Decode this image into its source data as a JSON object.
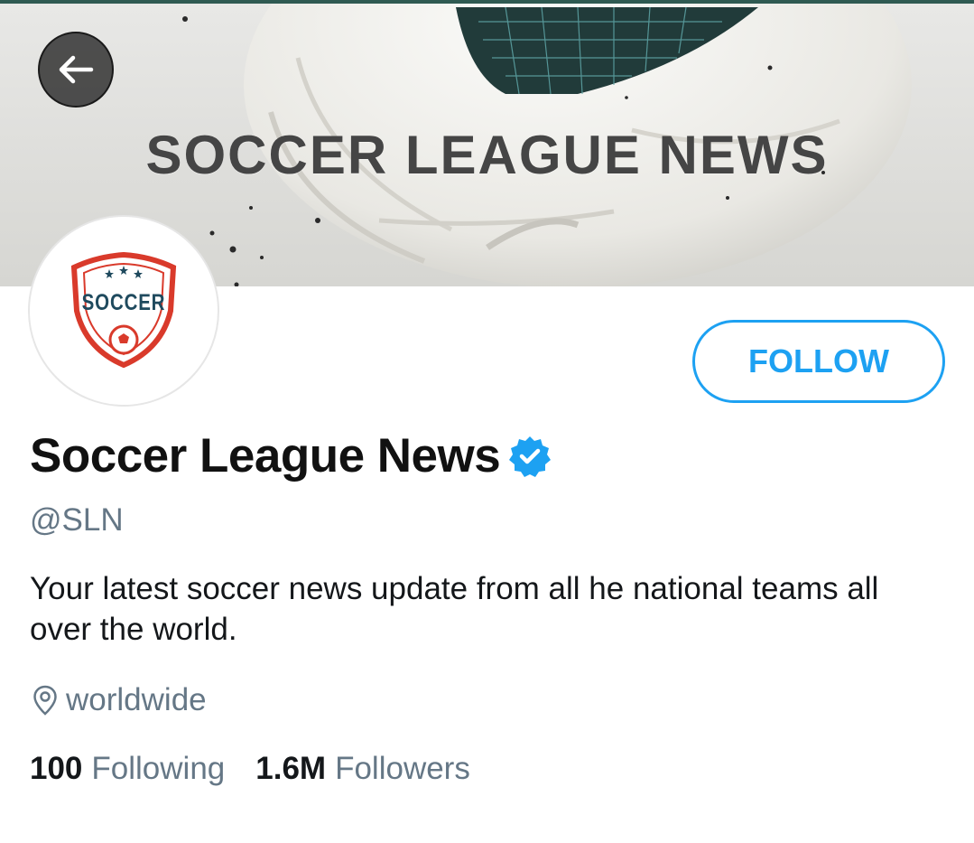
{
  "header": {
    "banner_title": "SOCCER LEAGUE NEWS",
    "back_icon": "arrow-left-icon"
  },
  "profile": {
    "avatar_text": "SOCCER",
    "avatar_icon": "soccer-shield-logo",
    "display_name": "Soccer League News",
    "verified_icon": "verified-badge-icon",
    "handle": "@SLN",
    "bio": "Your latest soccer news update from all he national teams all over the world.",
    "location_icon": "location-pin-icon",
    "location": "worldwide",
    "following_count": "100",
    "following_label": "Following",
    "followers_count": "1.6M",
    "followers_label": "Followers"
  },
  "actions": {
    "follow_label": "FOLLOW"
  },
  "colors": {
    "accent": "#1da1f2",
    "secondary_text": "#657786",
    "banner_text": "#454545",
    "logo_red": "#d93a2b",
    "logo_navy": "#1f4a5e"
  }
}
